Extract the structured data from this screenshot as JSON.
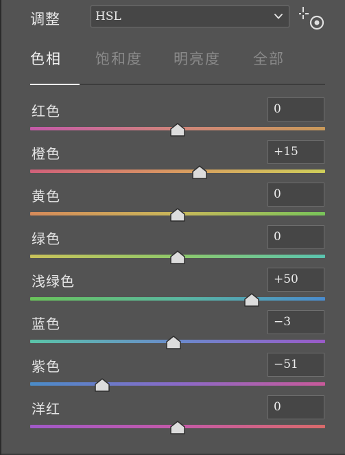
{
  "header": {
    "adjust_label": "调整",
    "mode_value": "HSL",
    "mode_chevron_icon": "chevron-down-icon",
    "target_tool_icon": "targeted-adjustment-tool-icon"
  },
  "tabs": [
    {
      "label": "色相",
      "active": true
    },
    {
      "label": "饱和度",
      "active": false
    },
    {
      "label": "明亮度",
      "active": false
    },
    {
      "label": "全部",
      "active": false
    }
  ],
  "slider_range": [
    -100,
    100
  ],
  "sliders": [
    {
      "label": "红色",
      "value": "0",
      "level": 0,
      "gradient": [
        "#c45aa8",
        "#d0857a",
        "#c99a5a"
      ]
    },
    {
      "label": "橙色",
      "value": "+15",
      "level": 15,
      "gradient": [
        "#d0607a",
        "#d99a60",
        "#cfcf5a"
      ]
    },
    {
      "label": "黄色",
      "value": "0",
      "level": 0,
      "gradient": [
        "#d68a5a",
        "#c9b85a",
        "#78c45a"
      ]
    },
    {
      "label": "绿色",
      "value": "0",
      "level": 0,
      "gradient": [
        "#c9c25a",
        "#8ec86a",
        "#5ac4b0"
      ]
    },
    {
      "label": "浅绿色",
      "value": "+50",
      "level": 50,
      "gradient": [
        "#6ac45a",
        "#5ab8a0",
        "#4a8ccf"
      ]
    },
    {
      "label": "蓝色",
      "value": "−3",
      "level": -3,
      "gradient": [
        "#5ac4a8",
        "#6a8acb",
        "#9a5ac8"
      ]
    },
    {
      "label": "紫色",
      "value": "−51",
      "level": -51,
      "gradient": [
        "#4a8cc8",
        "#8a6ac8",
        "#c85a9a"
      ]
    },
    {
      "label": "洋红",
      "value": "0",
      "level": 0,
      "gradient": [
        "#a05ac8",
        "#c45aa8",
        "#d86a6a"
      ]
    }
  ]
}
